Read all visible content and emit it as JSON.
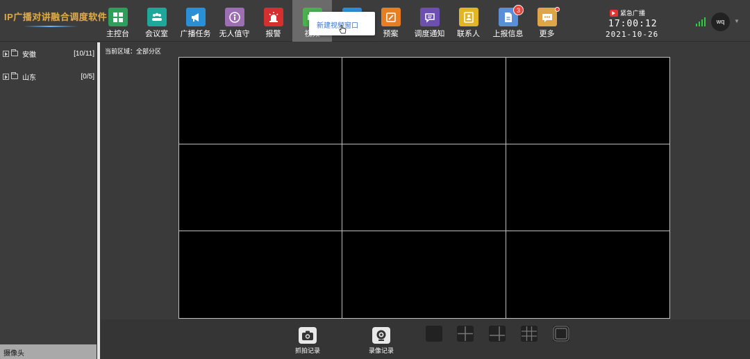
{
  "app": {
    "logo_text": "IP广播对讲融合调度软件"
  },
  "nav": [
    {
      "id": "console",
      "label": "主控台",
      "icon": "grid-icon",
      "color": "#2f9e5c"
    },
    {
      "id": "meeting",
      "label": "会议室",
      "icon": "group-icon",
      "color": "#1ea89a"
    },
    {
      "id": "broadcast",
      "label": "广播任务",
      "icon": "megaphone-icon",
      "color": "#2a8fd4"
    },
    {
      "id": "unattended",
      "label": "无人值守",
      "icon": "person-icon",
      "color": "#9c6fb3"
    },
    {
      "id": "alarm",
      "label": "报警",
      "icon": "siren-icon",
      "color": "#d62f2f"
    },
    {
      "id": "video",
      "label": "视频",
      "icon": "video-icon",
      "color": "#4caf50"
    },
    {
      "id": "hidden",
      "label": "",
      "icon": "device-icon",
      "color": "#2a8fd4"
    },
    {
      "id": "plan",
      "label": "预案",
      "icon": "plan-icon",
      "color": "#e67e22"
    },
    {
      "id": "notice",
      "label": "调度通知",
      "icon": "chat-icon",
      "color": "#6c4fb0"
    },
    {
      "id": "contacts",
      "label": "联系人",
      "icon": "contacts-icon",
      "color": "#e2b522"
    },
    {
      "id": "report",
      "label": "上报信息",
      "icon": "report-icon",
      "color": "#5a8fd8",
      "badge": "3"
    },
    {
      "id": "more",
      "label": "更多",
      "icon": "more-icon",
      "color": "#e0a546",
      "dot": true
    }
  ],
  "popup": {
    "item": "新建视频窗口"
  },
  "status": {
    "emergency_label": "紧急广播",
    "time": "17:00:12",
    "date": "2021-10-26",
    "user": "wq"
  },
  "sidebar": {
    "items": [
      {
        "label": "安徽",
        "count": "[10/11]"
      },
      {
        "label": "山东",
        "count": "[0/5]"
      }
    ],
    "bottom_tab": "摄像头"
  },
  "main": {
    "area_label": "当前区域：全部分区",
    "capture_label": "抓拍记录",
    "record_label": "录像记录"
  },
  "colors": {
    "accent": "#3a73c9",
    "badge": "#e8453c"
  }
}
